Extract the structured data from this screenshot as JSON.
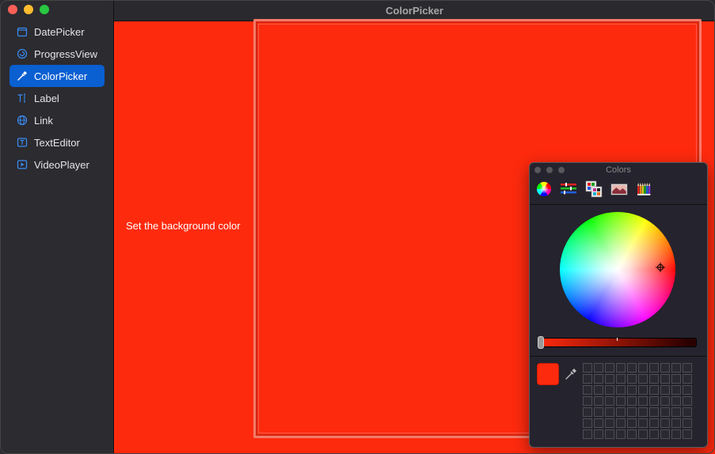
{
  "window": {
    "title": "ColorPicker",
    "background_color": "#fe2a0e"
  },
  "sidebar": {
    "items": [
      {
        "label": "DatePicker",
        "icon": "calendar-icon"
      },
      {
        "label": "ProgressView",
        "icon": "progress-icon"
      },
      {
        "label": "ColorPicker",
        "icon": "eyedropper-icon",
        "selected": true
      },
      {
        "label": "Label",
        "icon": "text-cursor-icon"
      },
      {
        "label": "Link",
        "icon": "globe-icon"
      },
      {
        "label": "TextEditor",
        "icon": "text-box-icon"
      },
      {
        "label": "VideoPlayer",
        "icon": "play-box-icon"
      }
    ]
  },
  "content": {
    "label": "Set the background color",
    "selected_color": "#fe2a0e"
  },
  "colors_panel": {
    "title": "Colors",
    "modes": [
      "color-wheel-icon",
      "sliders-icon",
      "palettes-icon",
      "image-icon",
      "pencils-icon"
    ],
    "current_color": "#fe2a0e",
    "brightness_fraction": 0.0
  },
  "accent": "#0a5fd1"
}
